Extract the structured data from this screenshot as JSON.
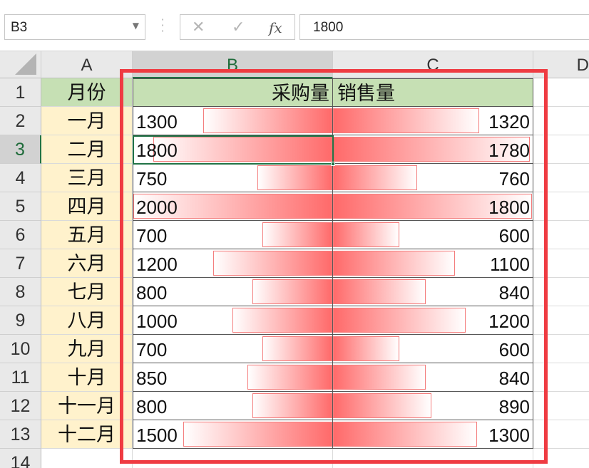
{
  "name_box": {
    "value": "B3"
  },
  "formula_bar": {
    "cancel_icon": "close-icon",
    "enter_icon": "check-icon",
    "fx_label": "fx",
    "value": "1800"
  },
  "columns": [
    "A",
    "B",
    "C",
    "D"
  ],
  "rows": [
    "1",
    "2",
    "3",
    "4",
    "5",
    "6",
    "7",
    "8",
    "9",
    "10",
    "11",
    "12",
    "13",
    "14"
  ],
  "selected_cell": "B3",
  "header": {
    "month": "月份",
    "purchase": "采购量",
    "sales": "销售量"
  },
  "data_rows": [
    {
      "month": "一月",
      "purchase": "1300",
      "sales": "1320"
    },
    {
      "month": "二月",
      "purchase": "1800",
      "sales": "1780"
    },
    {
      "month": "三月",
      "purchase": "750",
      "sales": "760"
    },
    {
      "month": "四月",
      "purchase": "2000",
      "sales": "1800"
    },
    {
      "month": "五月",
      "purchase": "700",
      "sales": "600"
    },
    {
      "month": "六月",
      "purchase": "1200",
      "sales": "1100"
    },
    {
      "month": "七月",
      "purchase": "800",
      "sales": "840"
    },
    {
      "month": "八月",
      "purchase": "1000",
      "sales": "1200"
    },
    {
      "month": "九月",
      "purchase": "700",
      "sales": "600"
    },
    {
      "month": "十月",
      "purchase": "850",
      "sales": "840"
    },
    {
      "month": "十一月",
      "purchase": "800",
      "sales": "890"
    },
    {
      "month": "十二月",
      "purchase": "1500",
      "sales": "1300"
    }
  ],
  "data_bar_max": {
    "purchase": 2000,
    "sales": 1800
  },
  "colors": {
    "header_fill": "#c6e0b4",
    "month_fill": "#fff2cc",
    "bar_color": "#ff6a6a",
    "highlight_frame": "#ef3b42",
    "selection": "#217346"
  }
}
